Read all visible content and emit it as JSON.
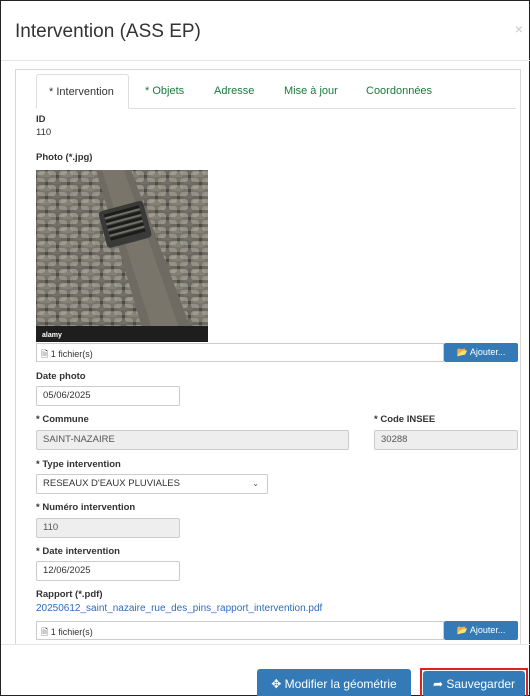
{
  "modal": {
    "title": "Intervention (ASS EP)",
    "close": "×"
  },
  "tabs": [
    {
      "label": "* Intervention"
    },
    {
      "label": "* Objets"
    },
    {
      "label": "Adresse"
    },
    {
      "label": "Mise à jour"
    },
    {
      "label": "Coordonnées"
    }
  ],
  "fields": {
    "id_label": "ID",
    "id_value": "110",
    "photo_label": "Photo (*.jpg)",
    "photo_watermark": "alamy",
    "photo_files": "1 fichier(s)",
    "add_label": "Ajouter...",
    "date_photo_label": "Date photo",
    "date_photo_value": "05/06/2025",
    "commune_label": "* Commune",
    "commune_value": "SAINT-NAZAIRE",
    "insee_label": "* Code INSEE",
    "insee_value": "30288",
    "type_label": "* Type intervention",
    "type_value": "RESEAUX D'EAUX PLUVIALES",
    "numero_label": "* Numéro intervention",
    "numero_value": "110",
    "date_intervention_label": "* Date intervention",
    "date_intervention_value": "12/06/2025",
    "rapport_label": "Rapport (*.pdf)",
    "rapport_file": "20250612_saint_nazaire_rue_des_pins_rapport_intervention.pdf",
    "rapport_files": "1 fichier(s)"
  },
  "footer": {
    "modify_geometry": "Modifier la géométrie",
    "save": "Sauvegarder"
  },
  "colors": {
    "primary": "#337ab7",
    "tab_text": "#1a7a3c",
    "highlight": "#d9251b"
  }
}
